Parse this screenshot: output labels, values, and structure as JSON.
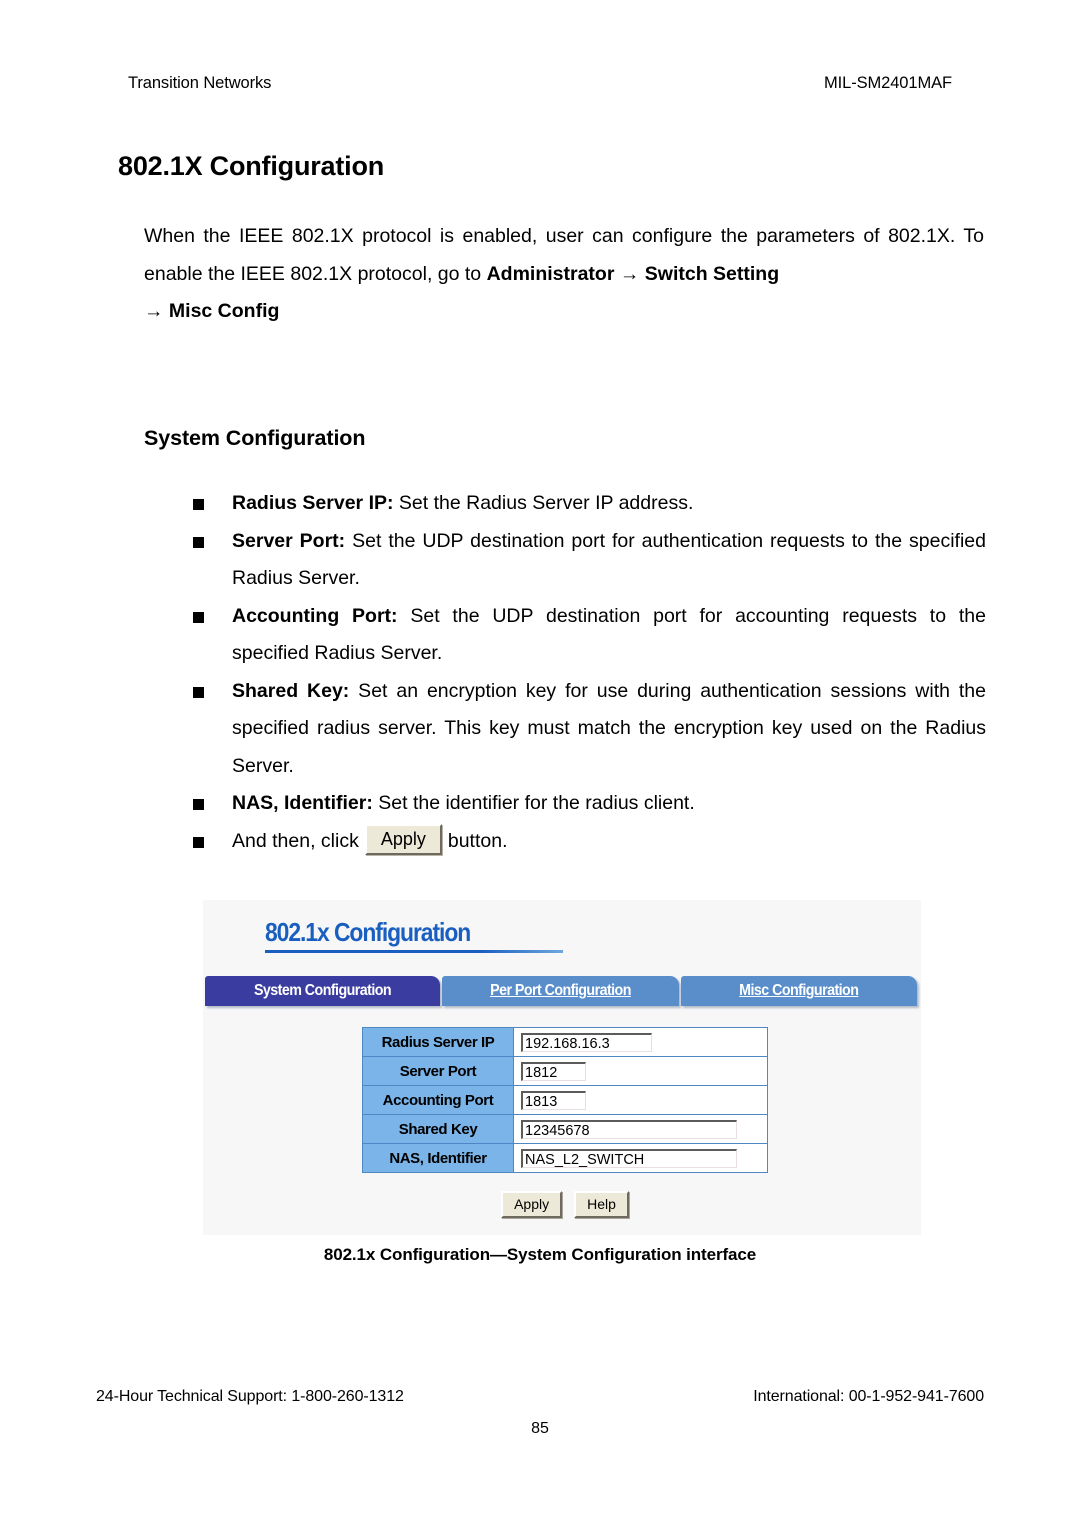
{
  "header": {
    "left": "Transition Networks",
    "right": "MIL-SM2401MAF"
  },
  "title": "802.1X Configuration",
  "intro": {
    "line1": "When the IEEE 802.1X protocol is enabled, user can configure the parameters of",
    "line2_a": "802.1X. To enable the IEEE 802.1X protocol, go to ",
    "line2_b": "Administrator",
    "line2_c": " → ",
    "line2_d": "Switch Setting",
    "line3": "→ Misc Config"
  },
  "section_title": "System Configuration",
  "bullets": [
    {
      "term": "Radius Server IP:",
      "text": " Set the Radius Server IP address."
    },
    {
      "term": "Server Port:",
      "text": " Set the UDP destination port for authentication requests to the specified Radius Server."
    },
    {
      "term": "Accounting Port:",
      "text": " Set the UDP destination port for accounting requests to the specified Radius Server."
    },
    {
      "term": "Shared Key:",
      "text": " Set an encryption key for use during authentication sessions with the specified radius server. This key must match the encryption key used on the Radius Server."
    },
    {
      "term": "NAS, Identifier:",
      "text": " Set the identifier for the radius client."
    }
  ],
  "apply_bullet": {
    "before": "And then, click",
    "button": "Apply",
    "after": "button."
  },
  "screenshot": {
    "title": "802.1x Configuration",
    "tabs": [
      {
        "label": "System Configuration",
        "active": true
      },
      {
        "label": "Per Port Configuration",
        "active": false
      },
      {
        "label": "Misc Configuration",
        "active": false
      }
    ],
    "fields": [
      {
        "label": "Radius Server IP",
        "value": "192.168.16.3"
      },
      {
        "label": "Server Port",
        "value": "1812"
      },
      {
        "label": "Accounting Port",
        "value": "1813"
      },
      {
        "label": "Shared Key",
        "value": "12345678"
      },
      {
        "label": "NAS, Identifier",
        "value": "NAS_L2_SWITCH"
      }
    ],
    "buttons": {
      "apply": "Apply",
      "help": "Help"
    },
    "colors": {
      "active_tab": "#3b3ca0",
      "inactive_tab": "#5a8ecb",
      "label_cell": "#7ab4e8",
      "title_blue": "#1a5fc0",
      "table_border": "#4f87c4",
      "panel_bg": "#f7f7f7"
    }
  },
  "caption": "802.1x Configuration—System Configuration interface",
  "footer": {
    "left": "24-Hour Technical Support: 1-800-260-1312",
    "right": "International: 00-1-952-941-7600",
    "page": "85"
  }
}
